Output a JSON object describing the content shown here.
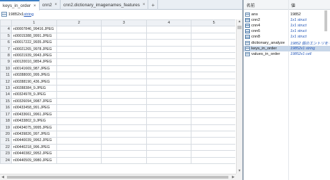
{
  "editor": {
    "tabs": [
      {
        "label": "keys_in_order",
        "active": true
      },
      {
        "label": "cnn2",
        "active": false
      },
      {
        "label": "cnn2.dictionary_imagenames_features",
        "active": false
      }
    ],
    "close_glyph": "×",
    "add_glyph": "+",
    "var_info": {
      "size": "19852x1",
      "type_link": "string"
    },
    "column_headers": [
      "1",
      "2",
      "3",
      "4",
      "5"
    ],
    "rows": [
      {
        "num": "4",
        "value": "n00007846_99416.JPEG"
      },
      {
        "num": "5",
        "value": "n00015388_9991.JPEG"
      },
      {
        "num": "6",
        "value": "n00017222_9935.JPEG"
      },
      {
        "num": "7",
        "value": "n00021265_9978.JPEG"
      },
      {
        "num": "8",
        "value": "n00021939_9943.JPEG"
      },
      {
        "num": "9",
        "value": "n00120010_9854.JPEG"
      },
      {
        "num": "10",
        "value": "n00141669_987.JPEG"
      },
      {
        "num": "11",
        "value": "n00288000_999.JPEG"
      },
      {
        "num": "12",
        "value": "n00288190_436.JPEG"
      },
      {
        "num": "13",
        "value": "n00288384_9.JPEG"
      },
      {
        "num": "14",
        "value": "n00324978_9.JPEG"
      },
      {
        "num": "15",
        "value": "n00326094_9987.JPEG"
      },
      {
        "num": "16",
        "value": "n00433458_991.JPEG"
      },
      {
        "num": "17",
        "value": "n00433661_9961.JPEG"
      },
      {
        "num": "18",
        "value": "n00433802_9.JPEG"
      },
      {
        "num": "19",
        "value": "n00434075_9995.JPEG"
      },
      {
        "num": "20",
        "value": "n00439826_997.JPEG"
      },
      {
        "num": "21",
        "value": "n00440039_9962.JPEG"
      },
      {
        "num": "22",
        "value": "n00440218_996.JPEG"
      },
      {
        "num": "23",
        "value": "n00440382_9952.JPEG"
      },
      {
        "num": "24",
        "value": "n00440509_9980.JPEG"
      }
    ]
  },
  "workspace": {
    "headers": {
      "name": "名前",
      "value": "値"
    },
    "variables": [
      {
        "name": "ans",
        "value": "19852",
        "kind": "numeric",
        "selected": false
      },
      {
        "name": "cnn2",
        "value": "1x1 struct",
        "kind": "struct",
        "selected": false
      },
      {
        "name": "cnn4",
        "value": "1x1 struct",
        "kind": "struct",
        "selected": false
      },
      {
        "name": "cnn6",
        "value": "1x1 struct",
        "kind": "struct",
        "selected": false
      },
      {
        "name": "cnn8",
        "value": "1x1 struct",
        "kind": "struct",
        "selected": false
      },
      {
        "name": "dictionary_analyze",
        "value": "19852 個のエントリをもつ辞書",
        "kind": "object",
        "selected": false
      },
      {
        "name": "keys_in_order",
        "value": "19852x1 string",
        "kind": "string",
        "selected": true
      },
      {
        "name": "values_in_order",
        "value": "19852x1 cell",
        "kind": "cell",
        "selected": false
      }
    ]
  },
  "colors": {
    "accent": "#3d7fc4",
    "link": "#2256b8",
    "selection": "#c7d6e8"
  }
}
